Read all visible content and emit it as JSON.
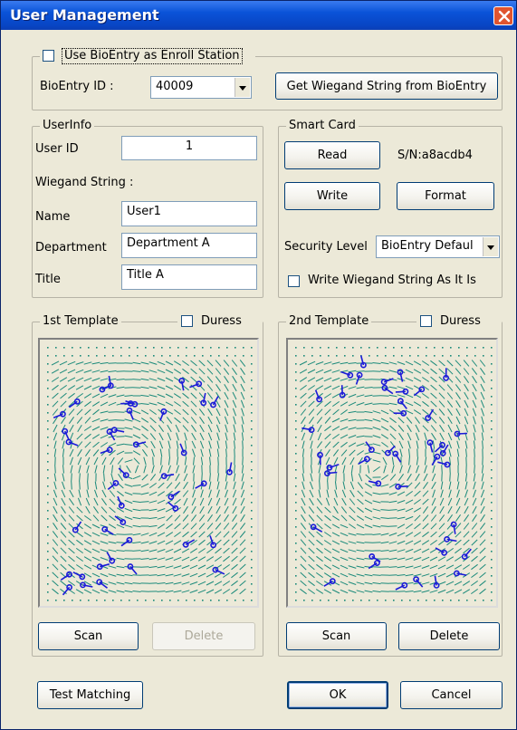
{
  "window": {
    "title": "User Management"
  },
  "enroll": {
    "use_bioentry_label": "Use BioEntry as Enroll Station",
    "bioentry_id_label": "BioEntry ID :",
    "bioentry_id_value": "40009",
    "get_wiegand_button": "Get Wiegand String from BioEntry"
  },
  "userinfo": {
    "legend": "UserInfo",
    "user_id_label": "User ID",
    "user_id_value": "1",
    "wiegand_label": "Wiegand String :",
    "name_label": "Name",
    "name_value": "User1",
    "department_label": "Department",
    "department_value": "Department A",
    "title_label": "Title",
    "title_value": "Title A"
  },
  "smartcard": {
    "legend": "Smart Card",
    "read_button": "Read",
    "serial_text": "S/N:a8acdb4",
    "write_button": "Write",
    "format_button": "Format",
    "security_level_label": "Security Level",
    "security_level_value": "BioEntry Defaul",
    "write_wiegand_label": "Write Wiegand String As It Is"
  },
  "template1": {
    "legend": "1st Template",
    "duress_label": "Duress",
    "scan_button": "Scan",
    "delete_button": "Delete"
  },
  "template2": {
    "legend": "2nd Template",
    "duress_label": "Duress",
    "scan_button": "Scan",
    "delete_button": "Delete"
  },
  "footer": {
    "test_matching_button": "Test Matching",
    "ok_button": "OK",
    "cancel_button": "Cancel"
  }
}
